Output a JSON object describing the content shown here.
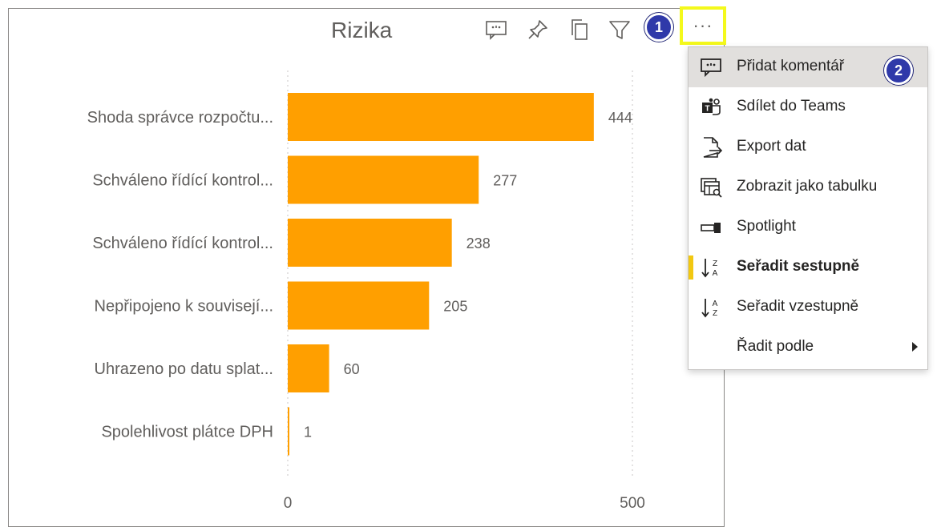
{
  "visual": {
    "title": "Rizika",
    "more_label": "···",
    "header_icons": [
      "comment-icon",
      "pin-icon",
      "copy-icon",
      "filter-icon"
    ]
  },
  "badges": {
    "step1": "1",
    "step2": "2",
    "color": "#2f39a9"
  },
  "menu": {
    "items": [
      {
        "label": "Přidat komentář",
        "icon": "comment-icon",
        "hover": true
      },
      {
        "label": "Sdílet do Teams",
        "icon": "teams-icon"
      },
      {
        "label": "Export dat",
        "icon": "export-icon"
      },
      {
        "label": "Zobrazit jako tabulku",
        "icon": "table-view-icon"
      },
      {
        "label": "Spotlight",
        "icon": "spotlight-icon"
      },
      {
        "label": "Seřadit sestupně",
        "icon": "sort-descending-icon",
        "active": true
      },
      {
        "label": "Seřadit vzestupně",
        "icon": "sort-ascending-icon"
      },
      {
        "label": "Řadit podle",
        "icon": "",
        "submenu": true
      }
    ],
    "active_color": "#f2c811",
    "hover_color": "#e1dfdd"
  },
  "chart_data": {
    "type": "bar",
    "orientation": "horizontal",
    "title": "Rizika",
    "categories": [
      "Shoda správce rozpočtu...",
      "Schváleno řídící kontrol...",
      "Schváleno řídící kontrol...",
      "Nepřipojeno k souvisejí...",
      "Uhrazeno po datu splat...",
      "Spolehlivost plátce DPH"
    ],
    "values": [
      444,
      277,
      238,
      205,
      60,
      1
    ],
    "xlim": [
      0,
      500
    ],
    "xticks": [
      0,
      500
    ],
    "grid": true,
    "bar_color": "#ff9f00",
    "show_data_labels": true
  }
}
